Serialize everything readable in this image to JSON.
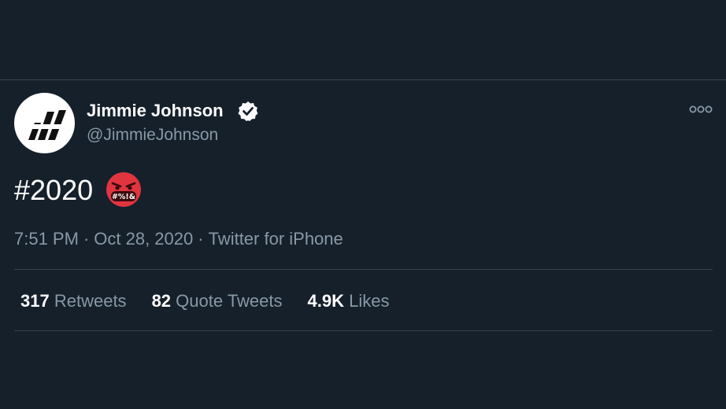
{
  "tweet": {
    "author": {
      "display_name": "Jimmie Johnson",
      "handle": "@JimmieJohnson",
      "verified": true,
      "avatar_icon": "jj-logo-icon"
    },
    "text": "#2020",
    "emoji_icon": "face-with-symbols-on-mouth-icon",
    "emoji_symbols": "#%!&",
    "time": "7:51 PM",
    "date": "Oct 28, 2020",
    "source": "Twitter for iPhone",
    "separator": "·",
    "stats": [
      {
        "count": "317",
        "label": "Retweets"
      },
      {
        "count": "82",
        "label": "Quote Tweets"
      },
      {
        "count": "4.9K",
        "label": "Likes"
      }
    ]
  },
  "colors": {
    "background": "#15202b",
    "divider": "#38444d",
    "primary_text": "#ffffff",
    "secondary_text": "#8899a6",
    "emoji_red": "#e0353f"
  }
}
